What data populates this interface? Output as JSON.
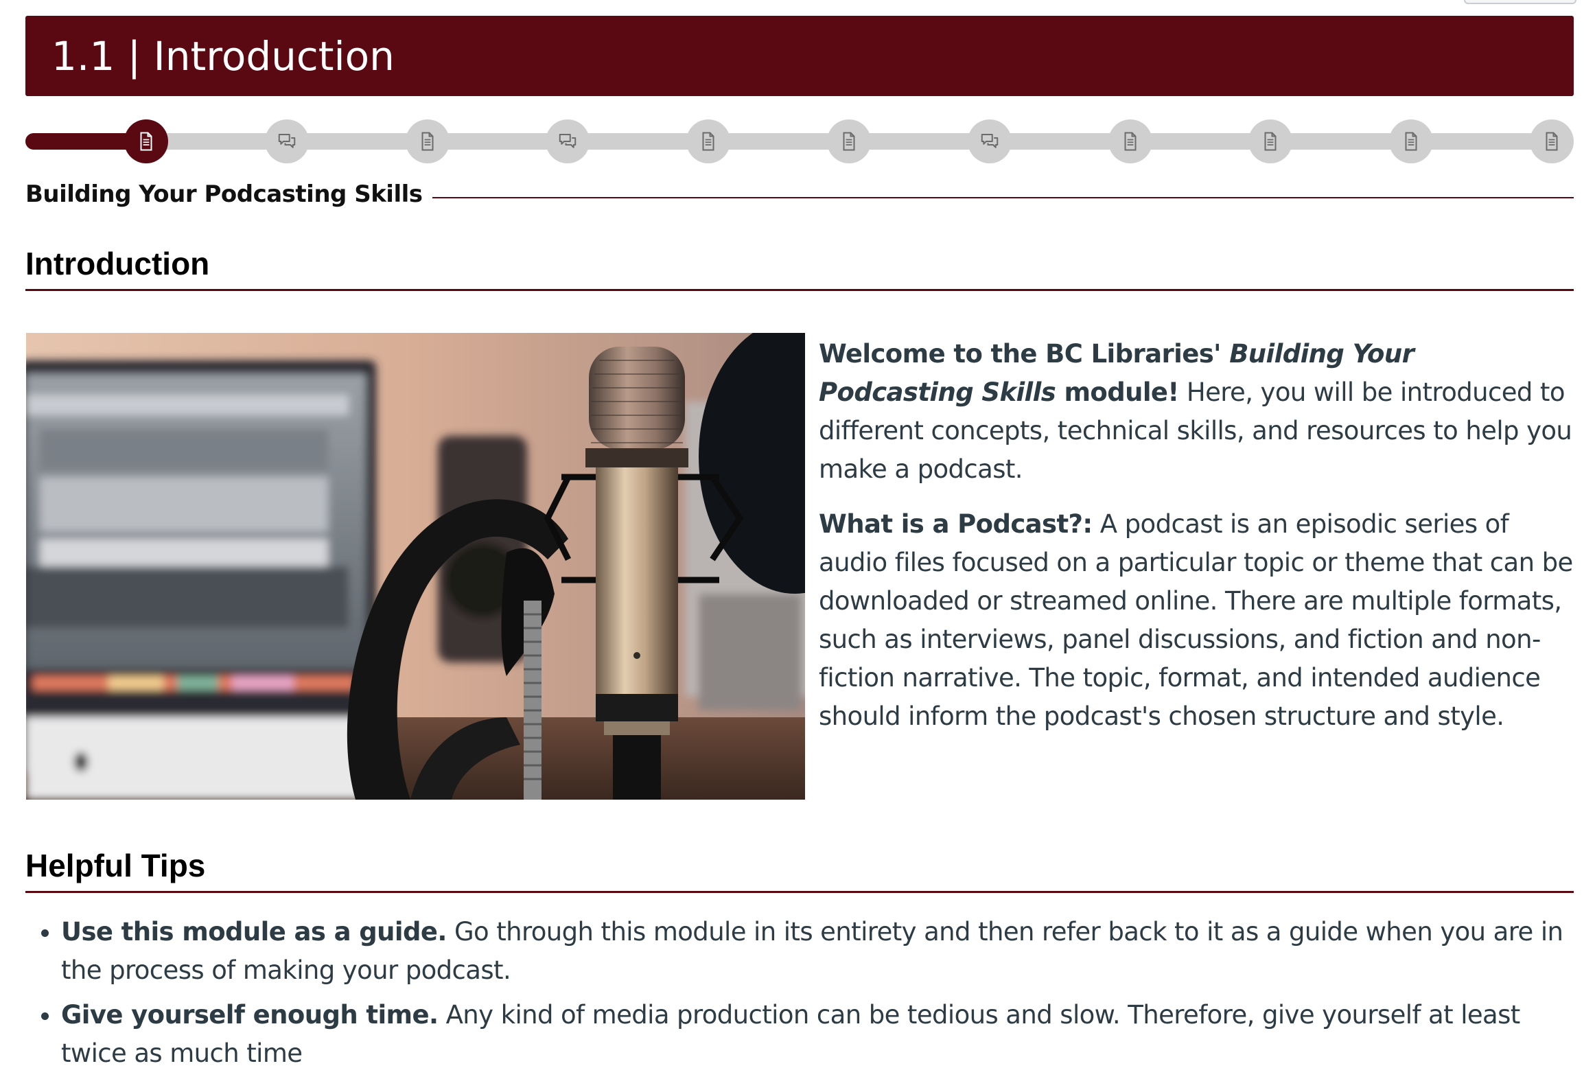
{
  "banner": {
    "title": "1.1 | Introduction",
    "color": "#5a0812"
  },
  "progress": {
    "current_step": 1,
    "total_steps": 11,
    "steps": [
      {
        "icon": "page-icon",
        "state": "current"
      },
      {
        "icon": "discussion-icon",
        "state": "upcoming"
      },
      {
        "icon": "page-icon",
        "state": "upcoming"
      },
      {
        "icon": "discussion-icon",
        "state": "upcoming"
      },
      {
        "icon": "page-icon",
        "state": "upcoming"
      },
      {
        "icon": "page-icon",
        "state": "upcoming"
      },
      {
        "icon": "discussion-icon",
        "state": "upcoming"
      },
      {
        "icon": "page-icon",
        "state": "upcoming"
      },
      {
        "icon": "page-icon",
        "state": "upcoming"
      },
      {
        "icon": "page-icon",
        "state": "upcoming"
      },
      {
        "icon": "page-icon",
        "state": "upcoming"
      }
    ],
    "active_color": "#5a0812",
    "inactive_color": "#cfcfcf"
  },
  "module": {
    "label": "Building Your Podcasting Skills"
  },
  "introduction": {
    "heading": "Introduction",
    "p1_bold_start": "Welcome to the BC Libraries' ",
    "p1_bold_italic": "Building Your Podcasting Skills",
    "p1_bold_end": " module!",
    "p1_text": " Here, you will be introduced to different concepts, technical skills, and resources to help you make a podcast.",
    "p2_bold": "What is a Podcast?:",
    "p2_text": " A podcast is an episodic series of audio files focused on a particular topic or theme that can be downloaded or streamed online. There are multiple formats, such as interviews, panel discussions, and fiction and non-fiction narrative. The topic, format, and intended audience should inform the podcast's chosen structure and style."
  },
  "tips": {
    "heading": "Helpful Tips",
    "items": [
      {
        "bold": "Use this module as a guide.",
        "text": " Go through this module in its entirety and then refer back to it as a guide when you are in the process of making your podcast."
      },
      {
        "bold": "Give yourself enough time.",
        "text": " Any kind of media production can be tedious and slow. Therefore, give yourself at least twice as much time"
      }
    ]
  }
}
